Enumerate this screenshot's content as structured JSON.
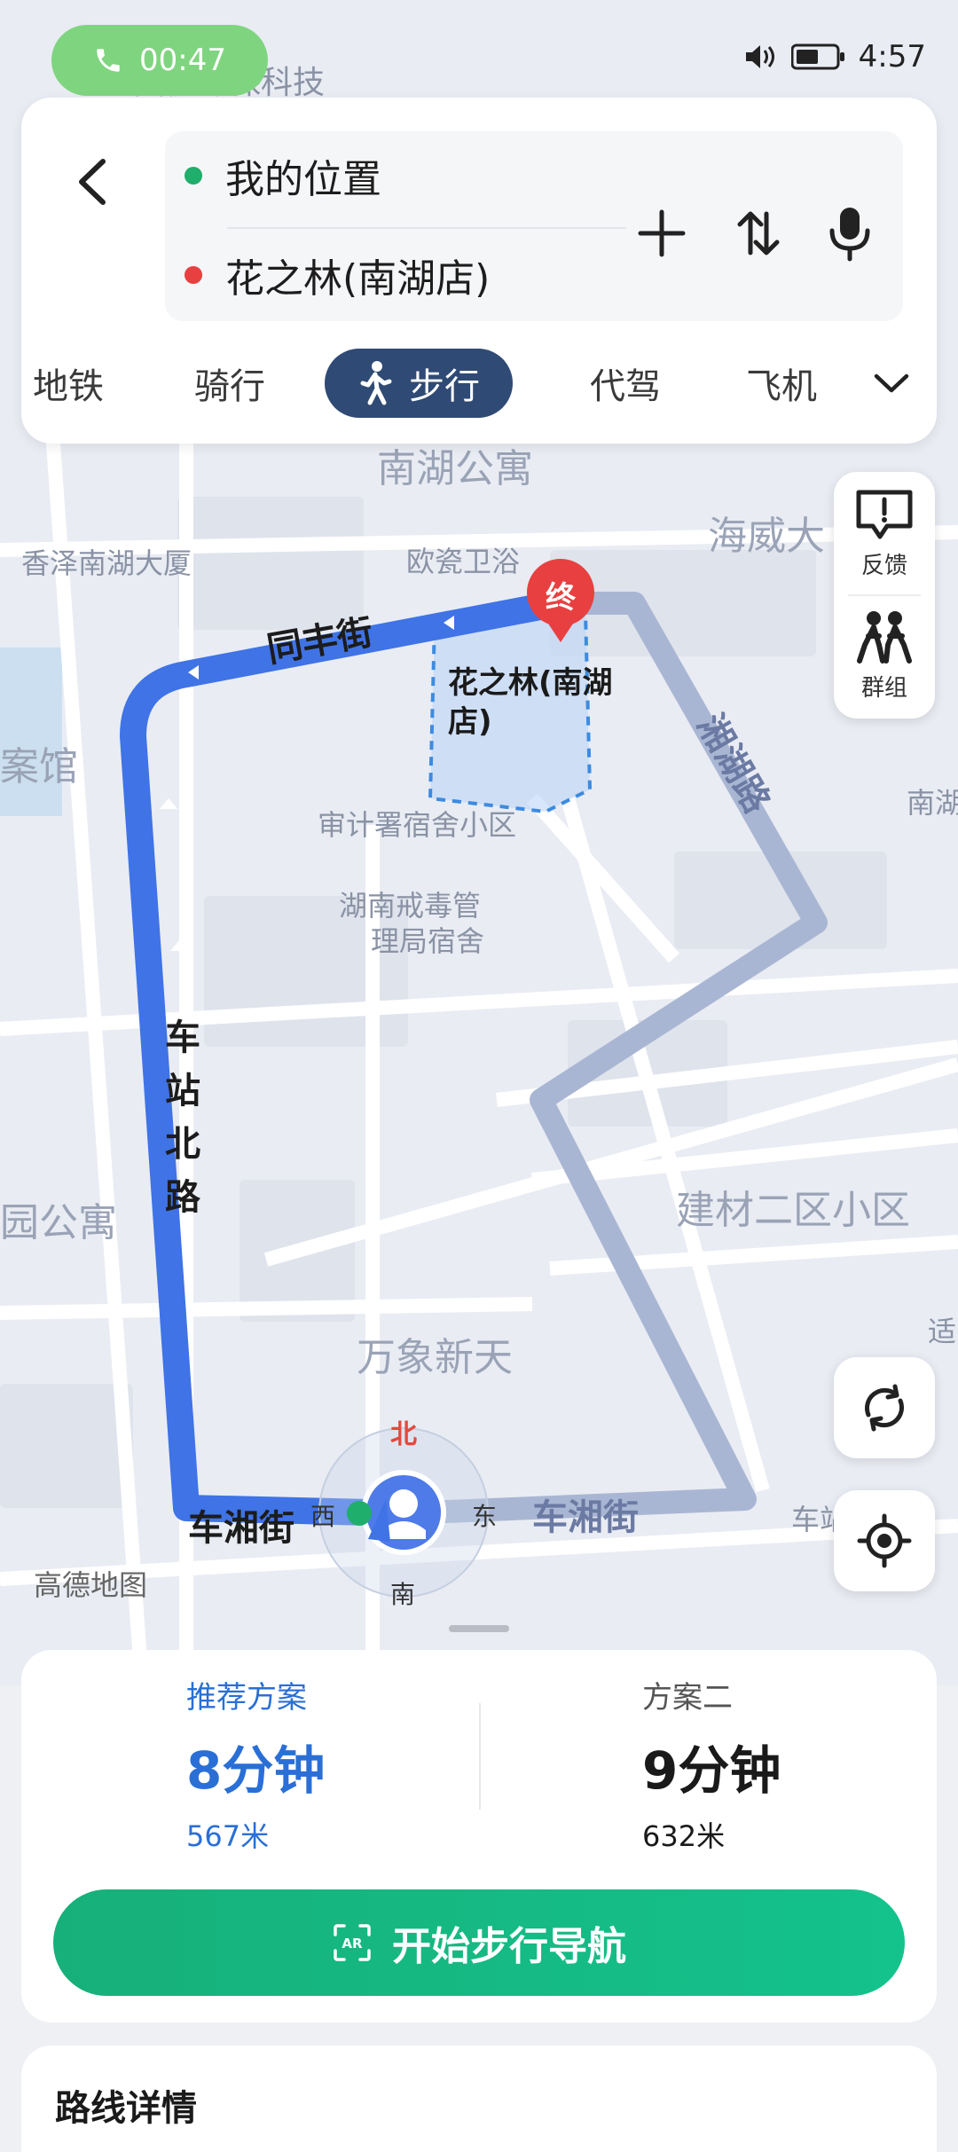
{
  "status": {
    "call_time": "00:47",
    "clock": "4:57"
  },
  "search": {
    "from": "我的位置",
    "to": "花之林(南湖店)"
  },
  "modes": [
    {
      "label": "地铁"
    },
    {
      "label": "骑行"
    },
    {
      "label": "步行",
      "active": true
    },
    {
      "label": "代驾"
    },
    {
      "label": "飞机"
    }
  ],
  "side": {
    "feedback": "反馈",
    "group": "群组"
  },
  "map": {
    "pois": {
      "guoxin": "国债环保科技",
      "nanhu_gongyu": "南湖公寓",
      "haiwei": "海威大",
      "xiangze": "香泽南湖大厦",
      "ouci": "欧瓷卫浴",
      "anguan": "案馆",
      "nanhu_r": "南湖",
      "shenji": "审计署宿舍小区",
      "jiedu_1": "湖南戒毒管",
      "jiedu_2": "理局宿舍",
      "yuan_gongyu": "园公寓",
      "jiancai": "建材二区小区",
      "wanxiang": "万象新天",
      "shi": "适",
      "chezhan_r": "车站",
      "gaode": "高德地图"
    },
    "roads": {
      "tongfeng": "同丰街",
      "xianghu": "湘湖路",
      "chezhan": "车站北路",
      "chexiang": "车湘街",
      "chexiang_east": "车湘街"
    },
    "destination_label": "花之林(南湖店)",
    "end_marker": "终",
    "compass": {
      "north": "北",
      "south": "南",
      "east": "东",
      "west": "西"
    }
  },
  "plans": [
    {
      "title": "推荐方案",
      "time": "8分钟",
      "distance": "567米",
      "color": "#2a6fd6"
    },
    {
      "title": "方案二",
      "time": "9分钟",
      "distance": "632米",
      "color": "#1a1a1a"
    }
  ],
  "actions": {
    "start": "开始步行导航"
  },
  "details": {
    "title": "路线详情"
  },
  "colors": {
    "accent": "#2f4a74",
    "route": "#3f73e6",
    "alt_route": "#a9b6d3",
    "start_btn": "#17b07a"
  }
}
